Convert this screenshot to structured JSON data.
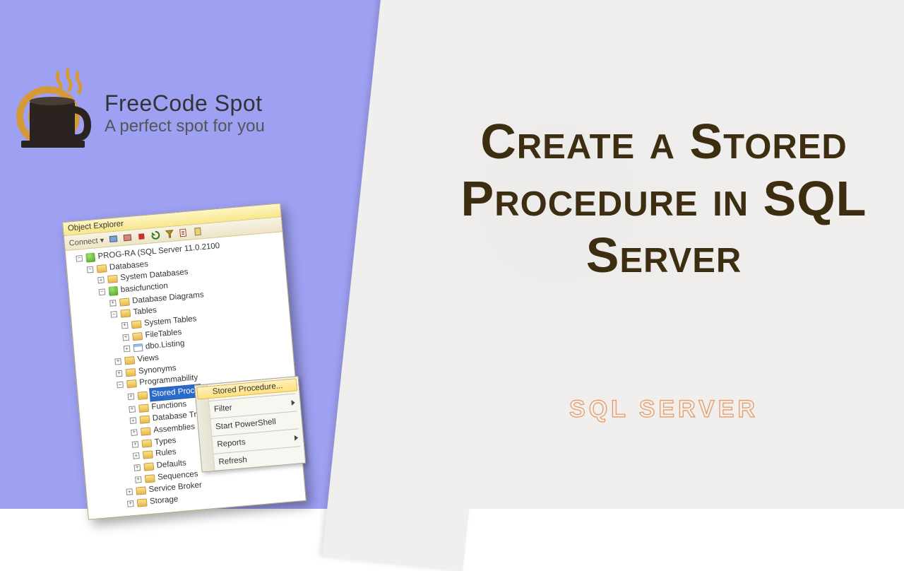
{
  "brand": {
    "name": "FreeCode Spot",
    "tagline": "A perfect spot for you"
  },
  "headline": "Create a Stored Procedure in SQL Server",
  "subheadline": "SQL SERVER",
  "explorer": {
    "title": "Object Explorer",
    "connect": "Connect ▾",
    "server": "PROG-RA (SQL Server 11.0.2100",
    "nodes": {
      "databases": "Databases",
      "system_databases": "System Databases",
      "basicfunction": "basicfunction",
      "database_diagrams": "Database Diagrams",
      "tables": "Tables",
      "system_tables": "System Tables",
      "filetables": "FileTables",
      "dbo_listing": "dbo.Listing",
      "views": "Views",
      "synonyms": "Synonyms",
      "programmability": "Programmability",
      "stored_proc": "Stored Proce",
      "functions": "Functions",
      "database_tr": "Database Tr",
      "assemblies": "Assemblies",
      "types": "Types",
      "rules": "Rules",
      "defaults": "Defaults",
      "sequences": "Sequences",
      "service_broker": "Service Broker",
      "storage": "Storage"
    }
  },
  "context_menu": {
    "items": [
      {
        "label": "Stored Procedure...",
        "highlighted": true
      },
      {
        "label": "Filter",
        "submenu": true
      },
      {
        "label": "Start PowerShell"
      },
      {
        "label": "Reports",
        "submenu": true
      },
      {
        "label": "Refresh"
      }
    ]
  }
}
